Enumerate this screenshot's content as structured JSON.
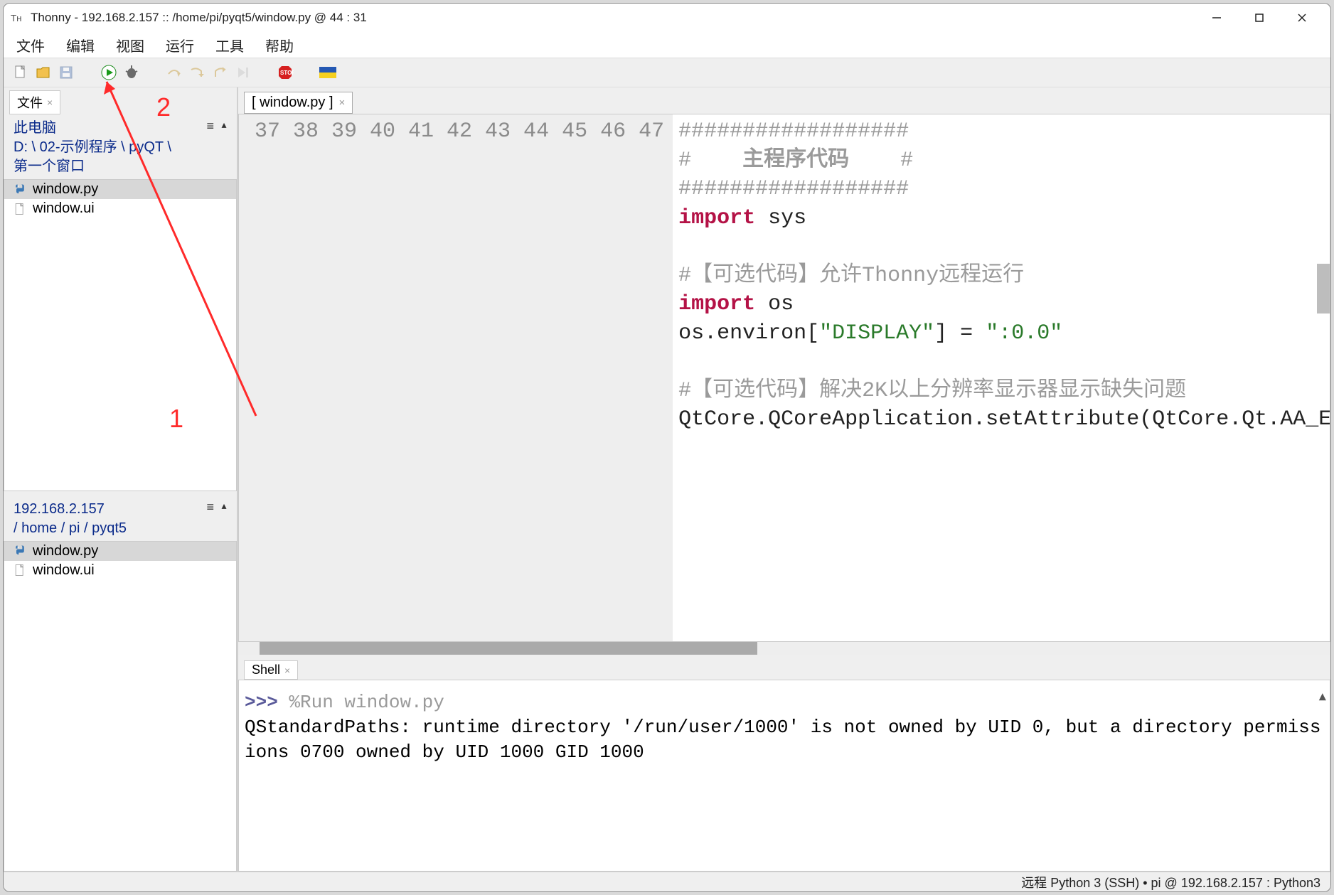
{
  "title": "Thonny  -  192.168.2.157 :: /home/pi/pyqt5/window.py  @  44 : 31",
  "menus": [
    "文件",
    "编辑",
    "视图",
    "运行",
    "工具",
    "帮助"
  ],
  "toolbar_icons": [
    "new-file-icon",
    "open-file-icon",
    "save-file-icon",
    "run-icon",
    "debug-icon",
    "step-over-icon",
    "step-into-icon",
    "step-out-icon",
    "resume-icon",
    "stop-icon",
    "ukraine-flag-icon"
  ],
  "left": {
    "tab_label": "文件",
    "local": {
      "root_label": "此电脑",
      "path_segments": [
        "D:",
        "02-示例程序",
        "pyQT",
        "第一个窗口"
      ],
      "files": [
        {
          "name": "window.py",
          "icon": "python",
          "selected": true
        },
        {
          "name": "window.ui",
          "icon": "file",
          "selected": false
        }
      ]
    },
    "remote": {
      "host": "192.168.2.157",
      "path_segments": [
        "home",
        "pi",
        "pyqt5"
      ],
      "files": [
        {
          "name": "window.py",
          "icon": "python",
          "selected": true
        },
        {
          "name": "window.ui",
          "icon": "file",
          "selected": false
        }
      ]
    }
  },
  "editor": {
    "tab_label": "[ window.py ]",
    "first_line_no": 37,
    "lines": [
      {
        "segs": [
          {
            "cls": "gray",
            "t": "##################"
          }
        ]
      },
      {
        "segs": [
          {
            "cls": "gray",
            "t": "#    "
          },
          {
            "cls": "gray-bold",
            "t": "主程序代码"
          },
          {
            "cls": "gray",
            "t": "    #"
          }
        ]
      },
      {
        "segs": [
          {
            "cls": "gray",
            "t": "##################"
          }
        ]
      },
      {
        "segs": [
          {
            "cls": "kw",
            "t": "import"
          },
          {
            "cls": "",
            "t": " sys"
          }
        ]
      },
      {
        "segs": [
          {
            "cls": "",
            "t": ""
          }
        ]
      },
      {
        "segs": [
          {
            "cls": "gray",
            "t": "#【可选代码】允许Thonny远程运行"
          }
        ]
      },
      {
        "segs": [
          {
            "cls": "kw",
            "t": "import"
          },
          {
            "cls": "",
            "t": " os"
          }
        ]
      },
      {
        "segs": [
          {
            "cls": "",
            "t": "os.environ["
          },
          {
            "cls": "str",
            "t": "\"DISPLAY\""
          },
          {
            "cls": "",
            "t": "] = "
          },
          {
            "cls": "str",
            "t": "\":0.0\""
          }
        ]
      },
      {
        "segs": [
          {
            "cls": "",
            "t": ""
          }
        ]
      },
      {
        "segs": [
          {
            "cls": "gray",
            "t": "#【可选代码】解决2K以上分辨率显示器显示缺失问题"
          }
        ]
      },
      {
        "segs": [
          {
            "cls": "",
            "t": "QtCore.QCoreApplication.setAttribute(QtCore.Qt.AA_E"
          }
        ]
      }
    ]
  },
  "shell": {
    "tab_label": "Shell",
    "prompt": ">>> ",
    "command": "%Run window.py",
    "output": "QStandardPaths: runtime directory '/run/user/1000' is not owned by UID 0, but a directory permissions 0700 owned by UID 1000 GID 1000"
  },
  "statusbar": "远程 Python 3 (SSH)  •  pi @ 192.168.2.157 : Python3",
  "annotations": {
    "1": "1",
    "2": "2"
  }
}
